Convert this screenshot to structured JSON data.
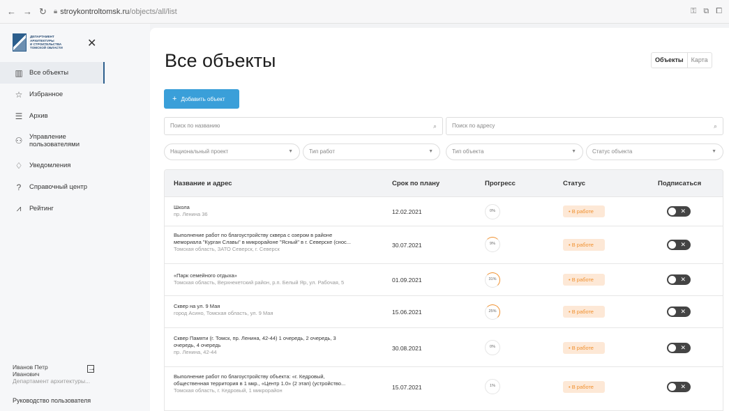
{
  "browser": {
    "url_host": "stroykontroltomsk.ru",
    "url_path": "/objects/all/list"
  },
  "sidebar": {
    "logo_text": [
      "ДЕПАРТАМЕНТ",
      "АРХИТЕКТУРЫ",
      "И СТРОИТЕЛЬСТВА",
      "ТОМСКОЙ ОБЛАСТИ"
    ],
    "items": [
      {
        "label": "Все объекты",
        "icon": "building-icon"
      },
      {
        "label": "Избранное",
        "icon": "star-icon"
      },
      {
        "label": "Архив",
        "icon": "archive-icon"
      },
      {
        "label": "Управление пользователями",
        "icon": "users-icon"
      },
      {
        "label": "Уведомления",
        "icon": "bell-icon"
      },
      {
        "label": "Справочный центр",
        "icon": "question-icon"
      },
      {
        "label": "Рейтинг",
        "icon": "chart-icon"
      }
    ],
    "user_name_line1": "Иванов Петр",
    "user_name_line2": "Иванович",
    "user_dept": "Департамент архитектуры...",
    "guide_link": "Руководство пользователя"
  },
  "main": {
    "title": "Все объекты",
    "view_toggle": {
      "list": "Объекты",
      "map": "Карта"
    },
    "add_button": "Добавить объект",
    "search_name_placeholder": "Поиск по названию",
    "search_address_placeholder": "Поиск по адресу",
    "filters": [
      "Национальный проект",
      "Тип работ",
      "Тип объекта",
      "Статус объекта"
    ],
    "columns": [
      "Название и адрес",
      "Срок по плану",
      "Прогресс",
      "Статус",
      "Подписаться"
    ]
  },
  "rows": [
    {
      "name": [
        "Школа"
      ],
      "address": "пр. Ленина 36",
      "date": "12.02.2021",
      "progress": "0%",
      "status": "В работе"
    },
    {
      "name": [
        "Выполнение работ по благоустройству сквера с озером в районе",
        "мемориала \"Курган Славы\" в микрорайоне \"Ясный\" в г. Северске (снос..."
      ],
      "address": "Томская область, ЗАТО Северск, г. Северск",
      "date": "30.07.2021",
      "progress": "9%",
      "status": "В работе"
    },
    {
      "name": [
        "«Парк семейного отдыха»"
      ],
      "address": "Томская область, Верхнекетский район, р.п. Белый Яр, ул. Рабочая, 5",
      "date": "01.09.2021",
      "progress": "31%",
      "status": "В работе"
    },
    {
      "name": [
        "Сквер на ул. 9 Мая"
      ],
      "address": "город Асино, Томская область, ул. 9 Мая",
      "date": "15.06.2021",
      "progress": "25%",
      "status": "В работе"
    },
    {
      "name": [
        "Сквер Памяти (г. Томск, пр. Ленина, 42-44) 1 очередь, 2 очередь, 3",
        "очередь, 4 очередь"
      ],
      "address": "пр. Ленина, 42-44",
      "date": "30.08.2021",
      "progress": "0%",
      "status": "В работе"
    },
    {
      "name": [
        "Выполнение работ по благоустройству объекта: «г. Кедровый,",
        "общественная территория в 1 мкр., «Центр 1.0» (2 этап) (устройство..."
      ],
      "address": "Томская область, г. Кедровый, 1 микрорайон",
      "date": "15.07.2021",
      "progress": "1%",
      "status": "В работе"
    }
  ],
  "colors": {
    "accent": "#3a9fd9",
    "status_bg": "#fde8d6",
    "status_text": "#f0902e",
    "progress_arc": "#f0902e"
  }
}
